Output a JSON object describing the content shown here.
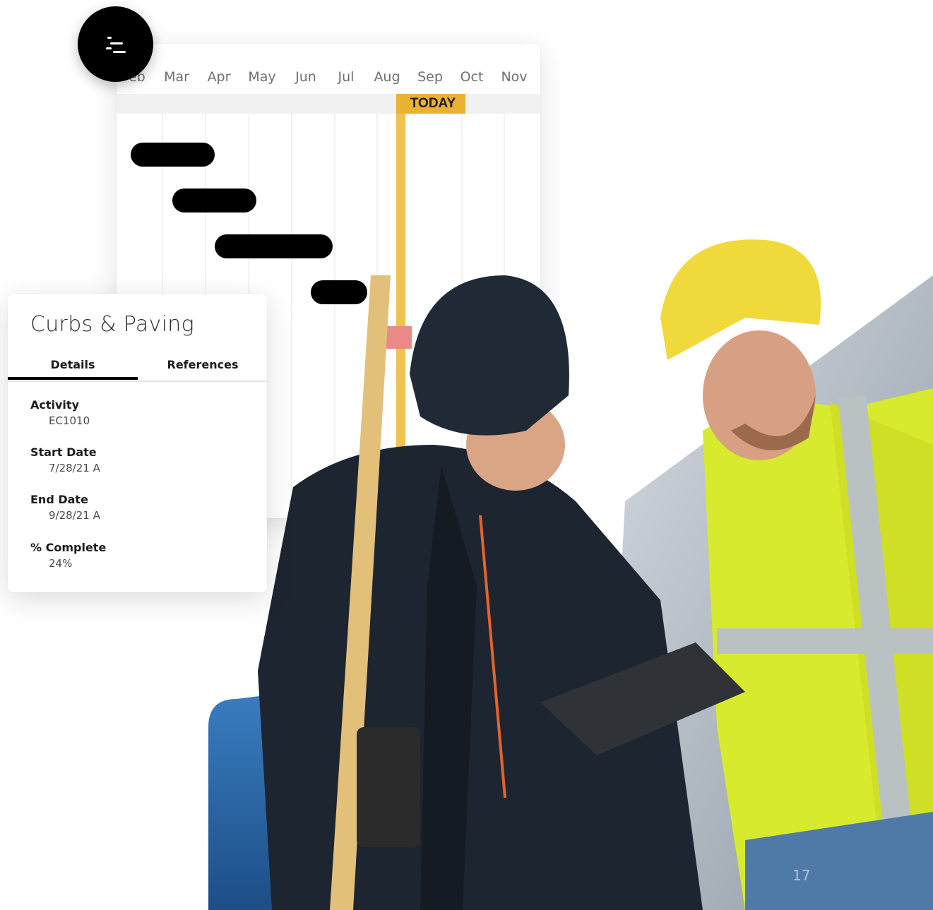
{
  "gantt": {
    "months": [
      "Feb",
      "Mar",
      "Apr",
      "May",
      "Jun",
      "Jul",
      "Aug",
      "Sep",
      "Oct",
      "Nov"
    ],
    "today_label": "TODAY",
    "colors": {
      "today": "#e9b233",
      "bar": "#000000",
      "marker": "#e98a88"
    }
  },
  "menu_button": {
    "icon": "gantt-menu-icon"
  },
  "details": {
    "title": "Curbs & Paving",
    "tabs": [
      {
        "label": "Details",
        "active": true
      },
      {
        "label": "References",
        "active": false
      }
    ],
    "fields": [
      {
        "label": "Activity",
        "value": "EC1010"
      },
      {
        "label": "Start Date",
        "value": "7/28/21 A"
      },
      {
        "label": "End Date",
        "value": "9/28/21 A"
      },
      {
        "label": "% Complete",
        "value": "24%"
      }
    ]
  },
  "photo": {
    "description_icon": "construction-workers-photo"
  },
  "page_number": "17"
}
